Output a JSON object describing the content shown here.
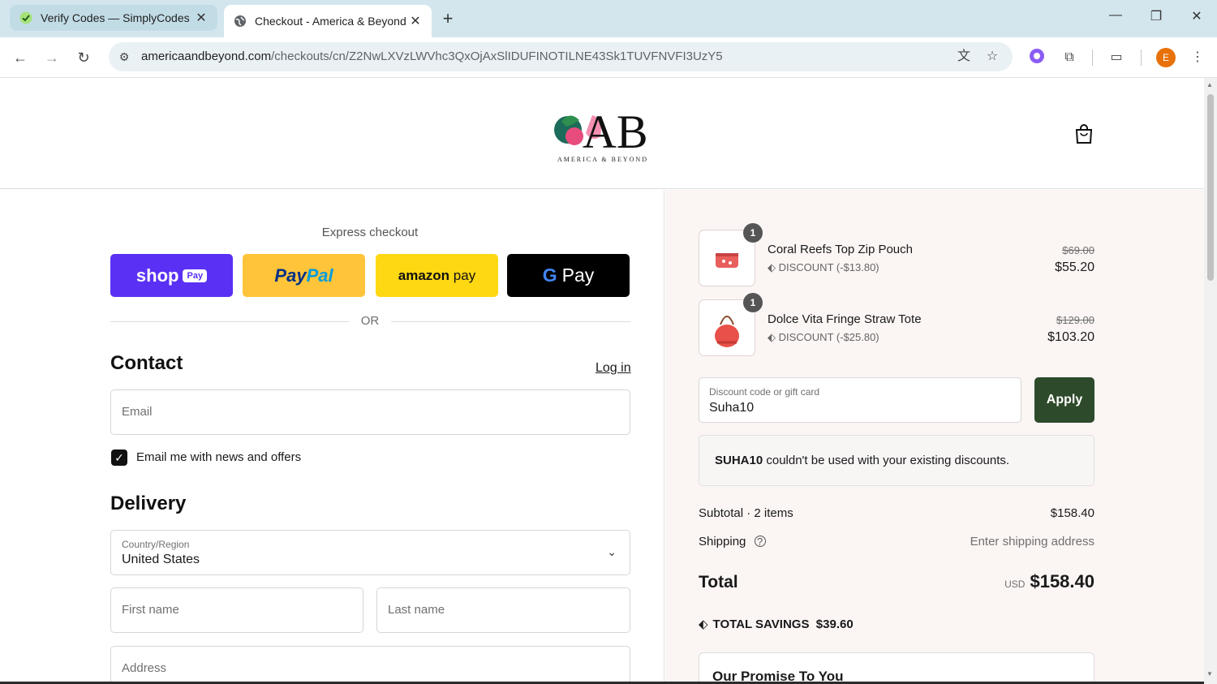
{
  "browser": {
    "tabs": [
      {
        "title": "Verify Codes — SimplyCodes",
        "active": false
      },
      {
        "title": "Checkout - America & Beyond",
        "active": true
      }
    ],
    "url_domain": "americaandbeyond.com",
    "url_path": "/checkouts/cn/Z2NwLXVzLWVhc3QxOjAxSlIDUFINOTILNE43Sk1TUVFNVFI3UzY5",
    "profile_initial": "E"
  },
  "store": {
    "logo_letters": "AB",
    "logo_subtitle": "AMERICA & BEYOND"
  },
  "express": {
    "label": "Express checkout",
    "shop_pay": {
      "shop": "shop",
      "pay": "Pay"
    },
    "paypal": {
      "pay": "Pay",
      "pal": "Pal"
    },
    "amazon": {
      "amazon": "amazon",
      "pay": "pay"
    },
    "gpay": {
      "g": "G",
      "pay": "Pay"
    },
    "or": "OR"
  },
  "contact": {
    "heading": "Contact",
    "login": "Log in",
    "email_placeholder": "Email",
    "newsletter_label": "Email me with news and offers",
    "newsletter_checked": true
  },
  "delivery": {
    "heading": "Delivery",
    "country_label": "Country/Region",
    "country_value": "United States",
    "first_name_placeholder": "First name",
    "last_name_placeholder": "Last name",
    "address_placeholder": "Address"
  },
  "cart": {
    "items": [
      {
        "name": "Coral Reefs Top Zip Pouch",
        "qty": "1",
        "discount": "DISCOUNT (-$13.80)",
        "old_price": "$69.00",
        "price": "$55.20"
      },
      {
        "name": "Dolce Vita Fringe Straw Tote",
        "qty": "1",
        "discount": "DISCOUNT (-$25.80)",
        "old_price": "$129.00",
        "price": "$103.20"
      }
    ],
    "discount_label": "Discount code or gift card",
    "discount_value": "Suha10",
    "apply_label": "Apply",
    "error_code": "SUHA10",
    "error_text": " couldn't be used with your existing discounts.",
    "subtotal_label": "Subtotal · 2 items",
    "subtotal_value": "$158.40",
    "shipping_label": "Shipping",
    "shipping_value": "Enter shipping address",
    "total_label": "Total",
    "total_currency": "USD",
    "total_value": "$158.40",
    "savings_label": "TOTAL SAVINGS",
    "savings_value": "$39.60",
    "promise_title": "Our Promise To You"
  },
  "colors": {
    "shop_pay": "#5a31f4",
    "paypal": "#ffc439",
    "amazon_pay": "#ffd814",
    "gpay": "#000000",
    "apply_button": "#2d4a2b",
    "summary_bg": "#fbf5f4"
  }
}
